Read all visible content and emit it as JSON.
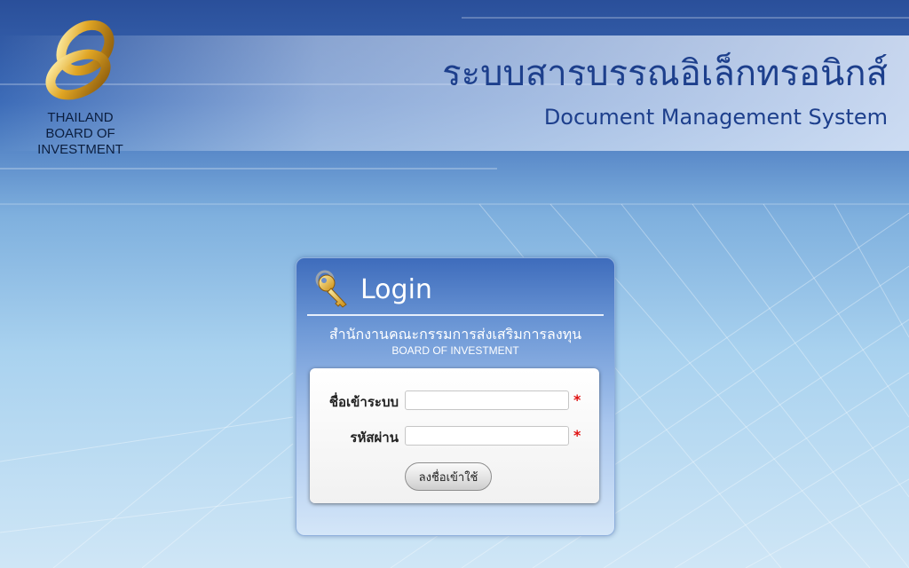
{
  "logo": {
    "name": "boi-logo",
    "lines": [
      "THAILAND",
      "BOARD OF",
      "INVESTMENT"
    ]
  },
  "banner": {
    "title_th": "ระบบสารบรรณอิเล็กทรอนิกส์",
    "title_en": "Document Management System"
  },
  "login": {
    "icon": "key-icon",
    "title": "Login",
    "org_th": "สำนักงานคณะกรรมการส่งเสริมการลงทุน",
    "org_en": "BOARD OF INVESTMENT",
    "username": {
      "label": "ชื่อเข้าระบบ",
      "value": "",
      "required_mark": "*"
    },
    "password": {
      "label": "รหัสผ่าน",
      "value": "",
      "required_mark": "*"
    },
    "submit_label": "ลงชื่อเข้าใช้"
  },
  "colors": {
    "brand_blue": "#1d3f8c",
    "gold": "#d9a21c",
    "required_red": "#e01010"
  }
}
